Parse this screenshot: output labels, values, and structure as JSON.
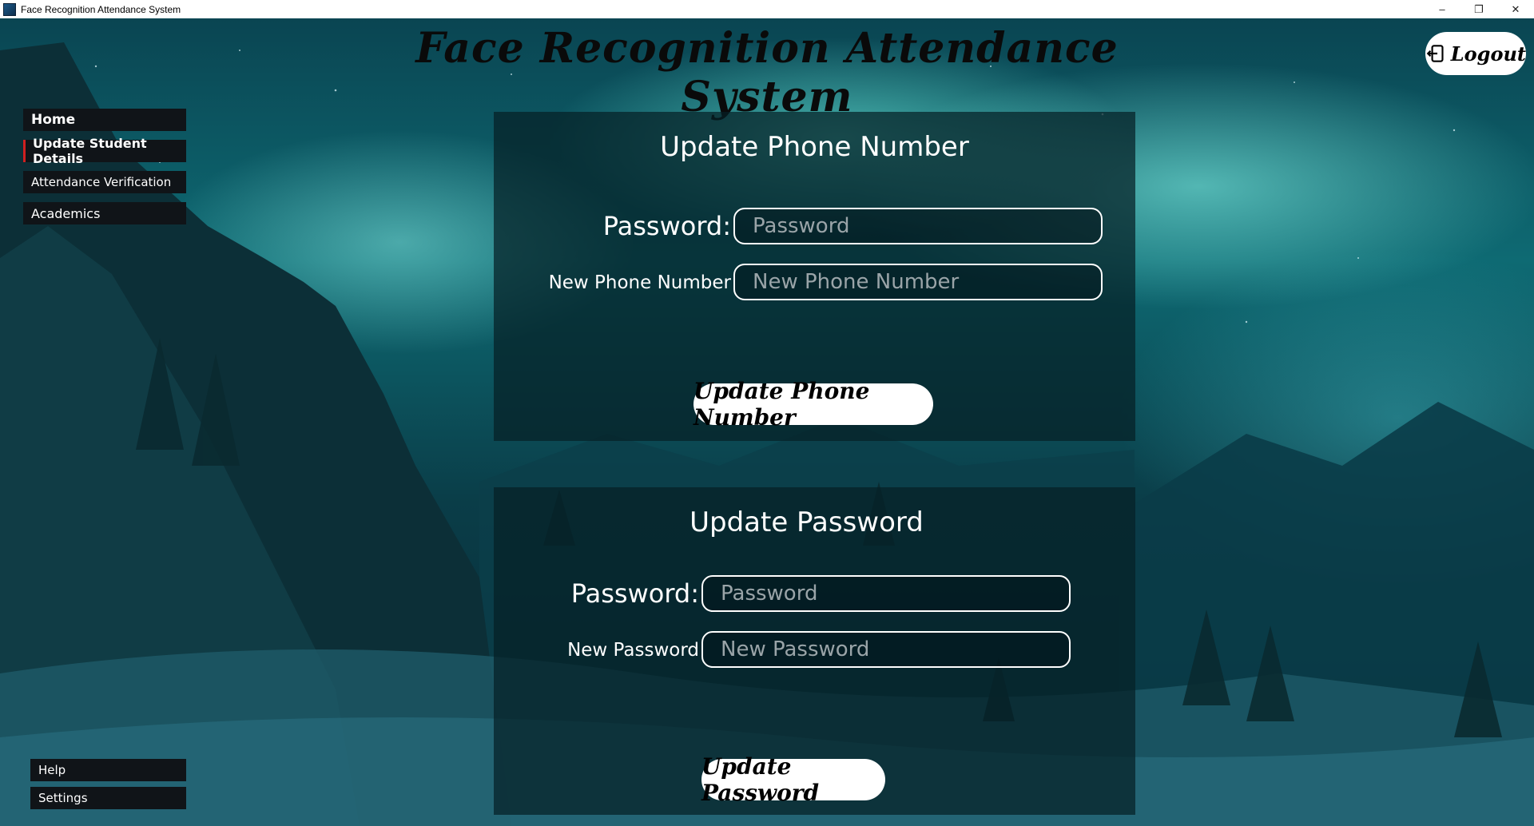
{
  "window": {
    "title": "Face Recognition Attendance System",
    "controls": [
      "–",
      "❐",
      "✕"
    ]
  },
  "header": {
    "title": "Face Recognition Attendance System",
    "logout_label": "Logout"
  },
  "sidebar": {
    "items": [
      {
        "label": "Home"
      },
      {
        "label": "Update Student Details"
      },
      {
        "label": "Attendance Verification"
      },
      {
        "label": "Academics"
      }
    ],
    "bottom_items": [
      {
        "label": "Help"
      },
      {
        "label": "Settings"
      }
    ]
  },
  "phone_panel": {
    "title": "Update Phone Number",
    "password_label": "Password:",
    "password_placeholder": "Password",
    "new_phone_label": "New Phone Number",
    "new_phone_placeholder": "New Phone Number",
    "submit_label": "Update Phone Number"
  },
  "password_panel": {
    "title": "Update Password",
    "password_label": "Password:",
    "password_placeholder": "Password",
    "new_password_label": "New Password",
    "new_password_placeholder": "New Password",
    "submit_label": "Update Password"
  },
  "colors": {
    "panel_bg": "#052026",
    "accent_red": "#d02020",
    "nav_bg": "#101418"
  }
}
